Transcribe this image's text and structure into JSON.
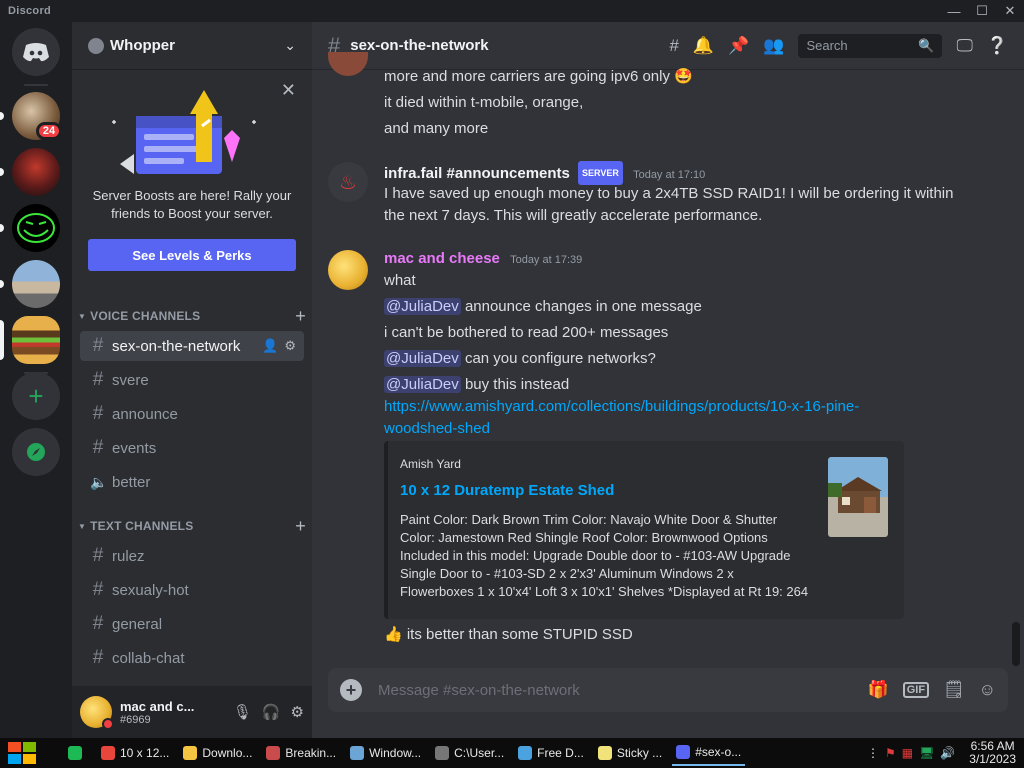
{
  "window": {
    "title": "Discord",
    "minimize_icon": "minimize-icon",
    "maximize_icon": "maximize-icon",
    "close_icon": "close-icon"
  },
  "guild_rail": {
    "home_icon": "discord-logo-icon",
    "servers": [
      {
        "name": "server-1",
        "badge": "24"
      },
      {
        "name": "server-2",
        "badge": ""
      },
      {
        "name": "server-3",
        "badge": ""
      },
      {
        "name": "server-4",
        "badge": ""
      },
      {
        "name": "Whopper",
        "badge": ""
      }
    ],
    "add_server_icon": "plus-icon",
    "explore_icon": "compass-icon"
  },
  "server": {
    "name": "Whopper",
    "boost_card": {
      "text": "Server Boosts are here! Rally your friends to Boost your server.",
      "button": "See Levels & Perks"
    },
    "categories": [
      {
        "label": "VOICE CHANNELS",
        "channels": [
          {
            "name": "sex-on-the-network",
            "type": "text",
            "active": true
          },
          {
            "name": "svere",
            "type": "text"
          },
          {
            "name": "announce",
            "type": "text"
          },
          {
            "name": "events",
            "type": "text"
          },
          {
            "name": "better",
            "type": "voice"
          }
        ]
      },
      {
        "label": "TEXT CHANNELS",
        "channels": [
          {
            "name": "rulez",
            "type": "text"
          },
          {
            "name": "sexualy-hot",
            "type": "text"
          },
          {
            "name": "general",
            "type": "text"
          },
          {
            "name": "collab-chat",
            "type": "text"
          }
        ]
      }
    ]
  },
  "user": {
    "name": "mac and c...",
    "tag": "#6969"
  },
  "channel_header": {
    "name": "sex-on-the-network",
    "search_placeholder": "Search"
  },
  "messages": {
    "prev_lines": [
      "more and more carriers are going ipv6 only 🤩",
      "it died within t-mobile, orange,",
      "and many more"
    ],
    "infra": {
      "author": "infra.fail #announcements",
      "tag": "SERVER",
      "timestamp": "Today at 17:10",
      "line1": "I have saved up enough money to buy a 2x4TB SSD RAID1! I will be ordering it within",
      "line2": "the next 7 days. This will greatly accelerate performance."
    },
    "mac": {
      "author": "mac and cheese",
      "timestamp": "Today at 17:39",
      "l1": "what",
      "mention": "@JuliaDev",
      "l2": "announce changes in one message",
      "l3": "i can't be bothered to read 200+ messages",
      "l4": "can you configure networks?",
      "l5": "buy this instead",
      "link1": "https://www.amishyard.com/collections/buildings/products/10-x-16-pine-",
      "link2": "woodshed-shed",
      "last": "👍 its better than some STUPID SSD"
    },
    "embed": {
      "provider": "Amish Yard",
      "title": "10 x 12 Duratemp Estate Shed",
      "desc1": "Paint Color: Dark Brown Trim Color: Navajo White Door & Shutter",
      "desc2": "Color:  Jamestown Red Shingle Roof Color: Brownwood Options",
      "desc3": "Included in this model: Upgrade Double door to - #103-AW Upgrade",
      "desc4": "Single Door to - #103-SD 2 x 2'x3' Aluminum Windows 2 x",
      "desc5": "Flowerboxes 1 x 10'x4' Loft 3 x 10'x1' Shelves *Displayed at Rt 19: 264"
    }
  },
  "composer": {
    "placeholder": "Message #sex-on-the-network"
  },
  "taskbar": {
    "items": [
      {
        "label": "",
        "color": "#1db954"
      },
      {
        "label": "10 x 12...",
        "color": "#e8453c"
      },
      {
        "label": "Downlo...",
        "color": "#f5c542"
      },
      {
        "label": "Breakin...",
        "color": "#c94b4b"
      },
      {
        "label": "Window...",
        "color": "#6aa5d6"
      },
      {
        "label": "C:\\User...",
        "color": "#777777"
      },
      {
        "label": "Free D...",
        "color": "#4aa3df"
      },
      {
        "label": "Sticky ...",
        "color": "#f2e27a"
      },
      {
        "label": "#sex-o...",
        "color": "#5865f2"
      }
    ],
    "time": "6:56 AM",
    "date": "3/1/2023"
  },
  "colors": {
    "accent": "#5865f2",
    "mac_author": "#e879f9",
    "infra_author": "#f2f3f5",
    "link": "#00a8fc"
  }
}
